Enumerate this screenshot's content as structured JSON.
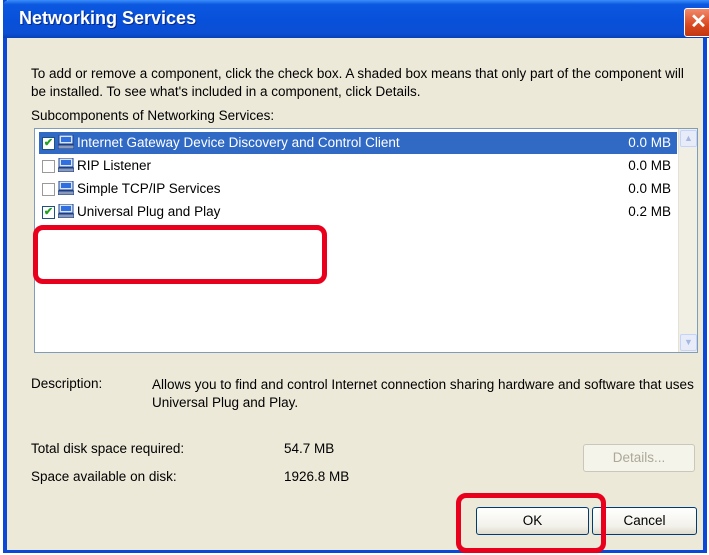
{
  "window": {
    "title": "Networking Services",
    "close_icon": "close-icon"
  },
  "instructions": "To add or remove a component, click the check box. A shaded box means that only part of the component will be installed. To see what's included in a component, click Details.",
  "subcomponents_label": "Subcomponents of Networking Services:",
  "components": [
    {
      "label": "Internet Gateway Device Discovery and Control Client",
      "size": "0.0 MB",
      "checked": true,
      "selected": true
    },
    {
      "label": "RIP Listener",
      "size": "0.0 MB",
      "checked": false,
      "selected": false
    },
    {
      "label": "Simple TCP/IP Services",
      "size": "0.0 MB",
      "checked": false,
      "selected": false
    },
    {
      "label": "Universal Plug and Play",
      "size": "0.2 MB",
      "checked": true,
      "selected": false
    }
  ],
  "description": {
    "caption": "Description:",
    "text": "Allows you to find and control Internet connection sharing hardware and software that uses Universal Plug and Play."
  },
  "disk": {
    "required_label": "Total disk space required:",
    "required_value": "54.7 MB",
    "available_label": "Space available on disk:",
    "available_value": "1926.8 MB"
  },
  "buttons": {
    "details": "Details...",
    "ok": "OK",
    "cancel": "Cancel"
  },
  "colors": {
    "titlebar": "#0850d9",
    "selection": "#316ac5",
    "annotation": "#e8001c"
  }
}
